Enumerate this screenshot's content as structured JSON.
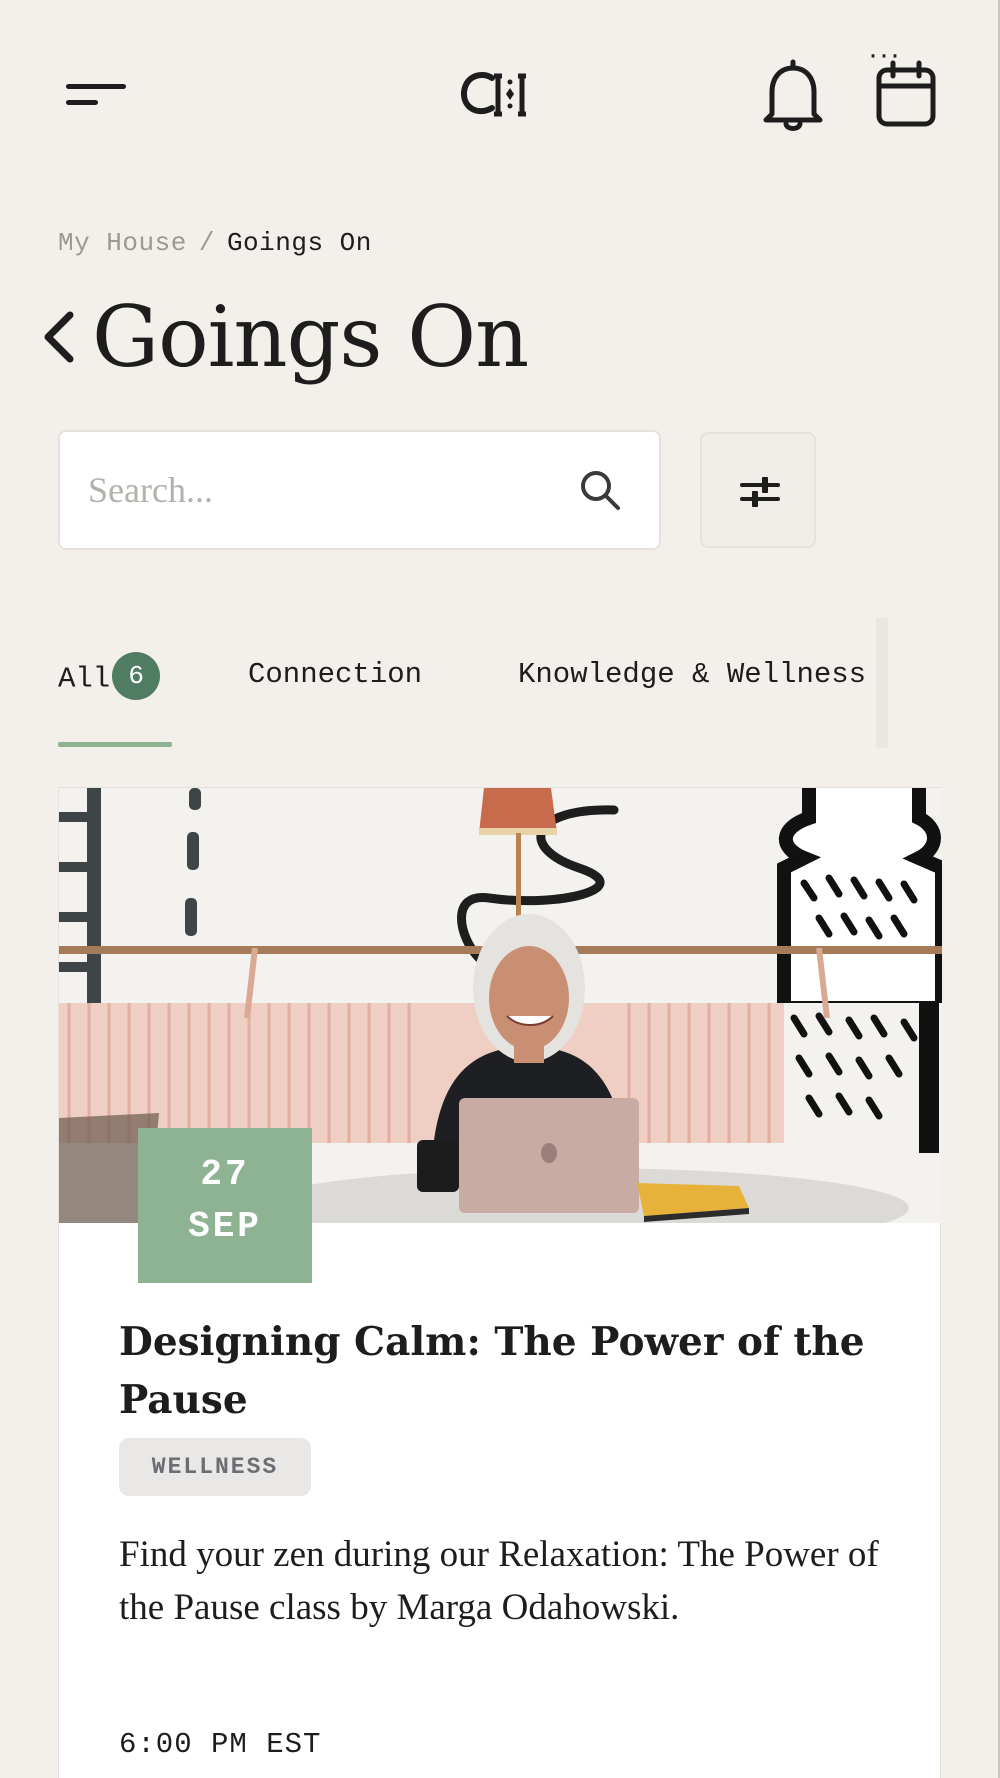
{
  "header": {
    "logo_text": "CH",
    "menu_icon": "hamburger-menu-icon",
    "notifications_icon": "bell-icon",
    "calendar_icon": "calendar-icon"
  },
  "breadcrumb": {
    "parent": "My House",
    "separator": "/",
    "current": "Goings On"
  },
  "page": {
    "title": "Goings On",
    "back_icon": "chevron-left-icon"
  },
  "search": {
    "placeholder": "Search...",
    "value": "",
    "icon": "search-icon"
  },
  "filter": {
    "icon": "sliders-icon"
  },
  "tabs": {
    "items": [
      {
        "label": "All",
        "count": "6",
        "active": true
      },
      {
        "label": "Connection"
      },
      {
        "label": "Knowledge & Wellness"
      }
    ],
    "more_label": "···",
    "colors": {
      "active_underline": "#8db392",
      "badge": "#4f7c63"
    }
  },
  "events": [
    {
      "day": "27",
      "month": "SEP",
      "title": "Designing Calm: The Power of the Pause",
      "tag": "WELLNESS",
      "description": "Find your zen during our Relaxation: The Power of the Pause class by Marga Odahowski.",
      "time": "6:00 PM EST",
      "image": "photo of smiling woman with laptop at cafe table"
    }
  ],
  "colors": {
    "background": "#f3efeb",
    "accent": "#8db392",
    "text": "#1d1d1d"
  }
}
